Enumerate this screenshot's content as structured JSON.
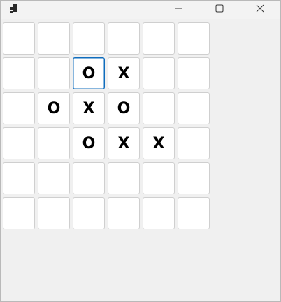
{
  "window": {
    "app_icon": "board-grid-icon",
    "controls": {
      "minimize_icon": "minimize-icon",
      "maximize_icon": "maximize-icon",
      "close_icon": "close-icon"
    }
  },
  "board": {
    "rows": 6,
    "cols": 6,
    "focused_cell": [
      1,
      2
    ],
    "cells": [
      [
        "",
        "",
        "",
        "",
        "",
        ""
      ],
      [
        "",
        "",
        "O",
        "X",
        "",
        ""
      ],
      [
        "",
        "O",
        "X",
        "O",
        "",
        ""
      ],
      [
        "",
        "",
        "O",
        "X",
        "X",
        ""
      ],
      [
        "",
        "",
        "",
        "",
        "",
        ""
      ],
      [
        "",
        "",
        "",
        "",
        "",
        ""
      ]
    ]
  },
  "colors": {
    "focus_border": "#0f6cbd",
    "cell_background": "#ffffff",
    "window_background": "#f0f0f0"
  }
}
